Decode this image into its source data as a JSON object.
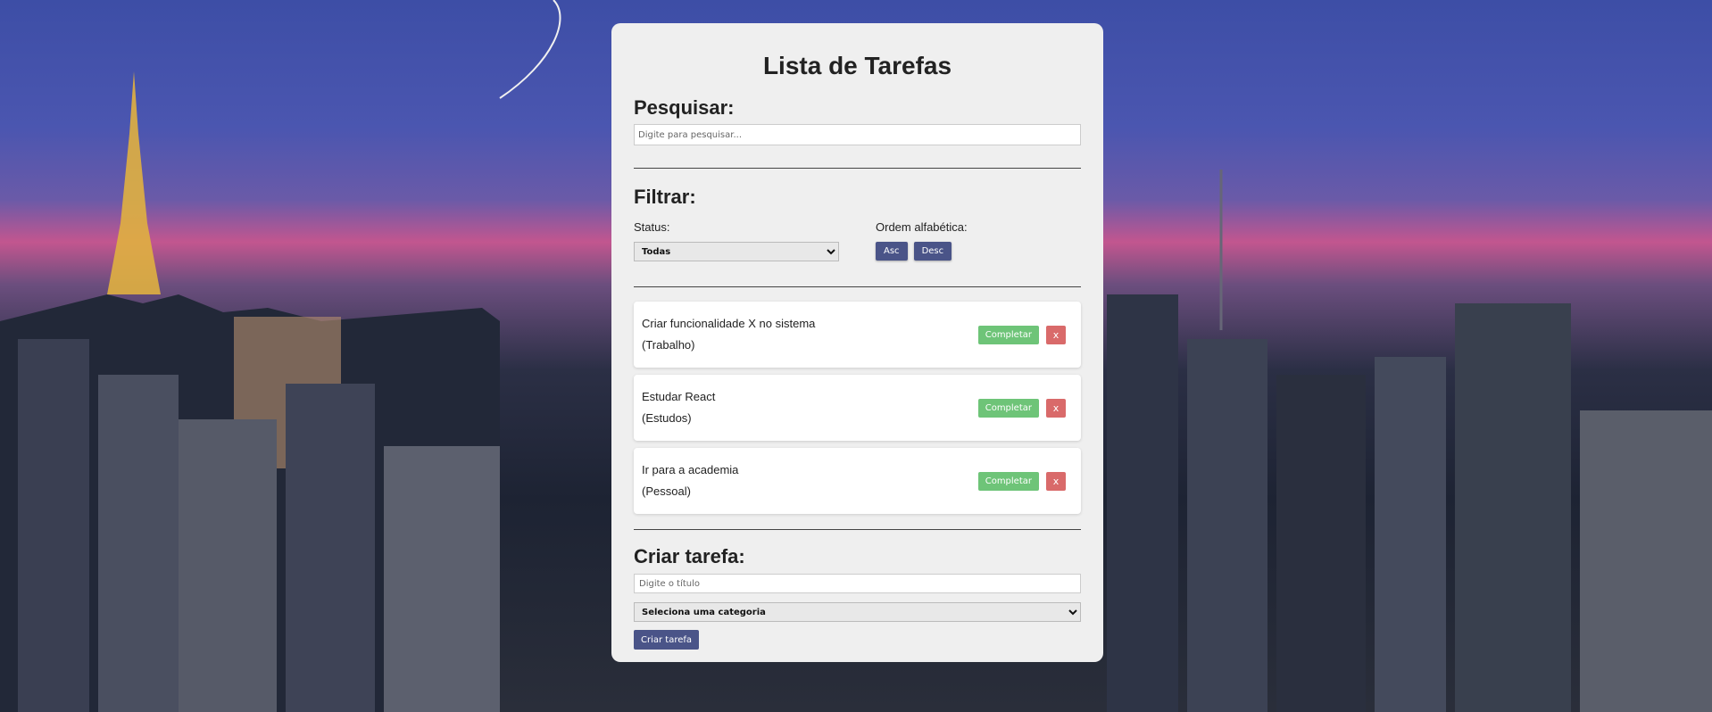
{
  "app": {
    "title": "Lista de Tarefas"
  },
  "search": {
    "heading": "Pesquisar:",
    "placeholder": "Digite para pesquisar..."
  },
  "filter": {
    "heading": "Filtrar:",
    "status_label": "Status:",
    "status_selected": "Todas",
    "order_label": "Ordem alfabética:",
    "asc_label": "Asc",
    "desc_label": "Desc"
  },
  "tasks": [
    {
      "title": "Criar funcionalidade X no sistema",
      "category": "(Trabalho)"
    },
    {
      "title": "Estudar React",
      "category": "(Estudos)"
    },
    {
      "title": "Ir para a academia",
      "category": "(Pessoal)"
    }
  ],
  "task_actions": {
    "complete_label": "Completar",
    "delete_label": "x"
  },
  "create": {
    "heading": "Criar tarefa:",
    "title_placeholder": "Digite o título",
    "category_selected": "Seleciona uma categoria",
    "submit_label": "Criar tarefa"
  },
  "colors": {
    "primary_button": "#4a5488",
    "complete_button": "#6ec478",
    "delete_button": "#d96a6a",
    "panel": "#efefef"
  }
}
